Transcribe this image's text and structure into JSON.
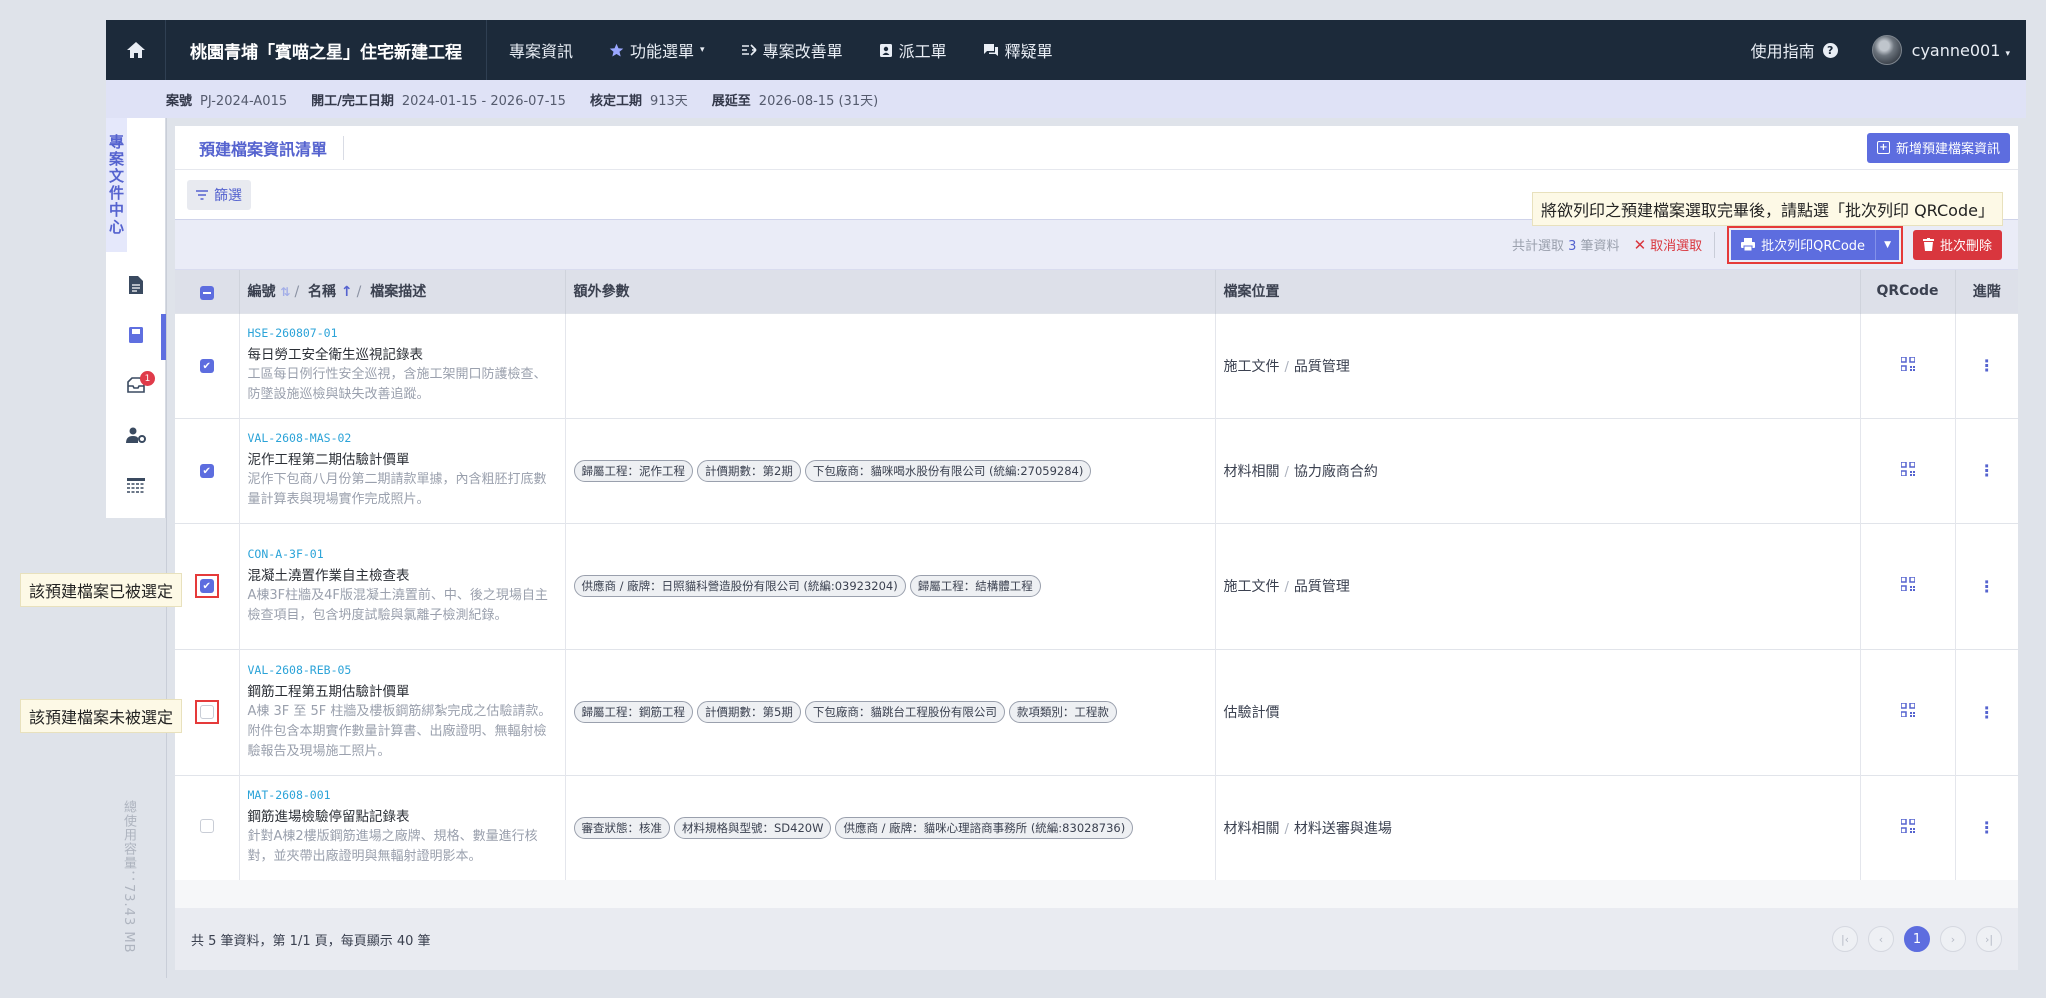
{
  "nav": {
    "project_title": "桃園青埔「賓喵之星」住宅新建工程",
    "items": [
      {
        "label": "專案資訊",
        "icon": ""
      },
      {
        "label": "功能選單",
        "icon": "star-icon",
        "caret": "▾"
      },
      {
        "label": "專案改善單",
        "icon": "list-improve-icon"
      },
      {
        "label": "派工單",
        "icon": "id-badge-icon"
      },
      {
        "label": "釋疑單",
        "icon": "chat-icon"
      }
    ],
    "guide_label": "使用指南",
    "username": "cyanne001",
    "user_caret": "▾"
  },
  "info": {
    "case_no_label": "案號",
    "case_no": "PJ-2024-A015",
    "dates_label": "開工/完工日期",
    "dates": "2024-01-15 - 2026-07-15",
    "period_label": "核定工期",
    "period": "913天",
    "ext_label": "展延至",
    "ext": "2026-08-15 (31天)"
  },
  "sidebar": {
    "title": "專案文件中心",
    "badge": "1",
    "storage": "總使用容量：73.43 MB"
  },
  "page": {
    "title": "預建檔案資訊清單",
    "add_label": "新增預建檔案資訊",
    "filter_label": "篩選"
  },
  "actions": {
    "sel_prefix": "共計選取",
    "sel_count": "3",
    "sel_suffix": "筆資料",
    "cancel_label": "取消選取",
    "print_label": "批次列印QRCode",
    "delete_label": "批次刪除"
  },
  "table": {
    "headers": {
      "code": "編號",
      "name": "名稱",
      "desc": "檔案描述",
      "extra": "額外參數",
      "loc": "檔案位置",
      "qr": "QRCode",
      "more": "進階"
    },
    "rows": [
      {
        "code": "HSE-260807-01",
        "name": "每日勞工安全衛生巡視記錄表",
        "desc": "工區每日例行性安全巡視，含施工架開口防護檢查、防墜設施巡檢與缺失改善追蹤。",
        "tags": [],
        "loc": [
          "施工文件",
          "品質管理"
        ]
      },
      {
        "code": "VAL-2608-MAS-02",
        "name": "泥作工程第二期估驗計價單",
        "desc": "泥作下包商八月份第二期請款單據，內含粗胚打底數量計算表與現場實作完成照片。",
        "tags": [
          "歸屬工程：泥作工程",
          "計價期數：第2期",
          "下包廠商：貓咪喝水股份有限公司 (統編:27059284)"
        ],
        "loc": [
          "材料相關",
          "協力廠商合約"
        ]
      },
      {
        "code": "CON-A-3F-01",
        "name": "混凝土澆置作業自主檢查表",
        "desc": "A棟3F柱牆及4F版混凝土澆置前、中、後之現場自主檢查項目，包含坍度試驗與氯離子檢測紀錄。",
        "tags": [
          "供應商 / 廠牌：日照貓科營造股份有限公司 (統編:03923204)",
          "歸屬工程：結構體工程"
        ],
        "loc": [
          "施工文件",
          "品質管理"
        ]
      },
      {
        "code": "VAL-2608-REB-05",
        "name": "鋼筋工程第五期估驗計價單",
        "desc": "A棟 3F 至 5F 柱牆及樓板鋼筋綁紮完成之估驗請款。附件包含本期實作數量計算書、出廠證明、無輻射檢驗報告及現場施工照片。",
        "tags": [
          "歸屬工程：鋼筋工程",
          "計價期數：第5期",
          "下包廠商：貓跳台工程股份有限公司",
          "款項類別：工程款"
        ],
        "loc": [
          "估驗計價"
        ]
      },
      {
        "code": "MAT-2608-001",
        "name": "鋼筋進場檢驗停留點記錄表",
        "desc": "針對A棟2樓版鋼筋進場之廠牌、規格、數量進行核對，並夾帶出廠證明與無輻射證明影本。",
        "tags": [
          "審查狀態：核准",
          "材料規格與型號：SD420W",
          "供應商 / 廠牌：貓咪心理諮商事務所 (統編:83028736)"
        ],
        "loc": [
          "材料相關",
          "材料送審與進場"
        ]
      }
    ]
  },
  "footer": {
    "summary": "共 5 筆資料，第 1/1 頁，每頁顯示 40 筆",
    "current_page": "1"
  },
  "callouts": {
    "print_hint": "將欲列印之預建檔案選取完畢後，請點選「批次列印 QRCode」",
    "selected_hint": "該預建檔案已被選定",
    "unselected_hint": "該預建檔案未被選定"
  },
  "colors": {
    "nav_bg": "#1c2a3a",
    "accent": "#5d6ddf",
    "danger": "#d9363e",
    "code_blue": "#2ba3d8"
  }
}
